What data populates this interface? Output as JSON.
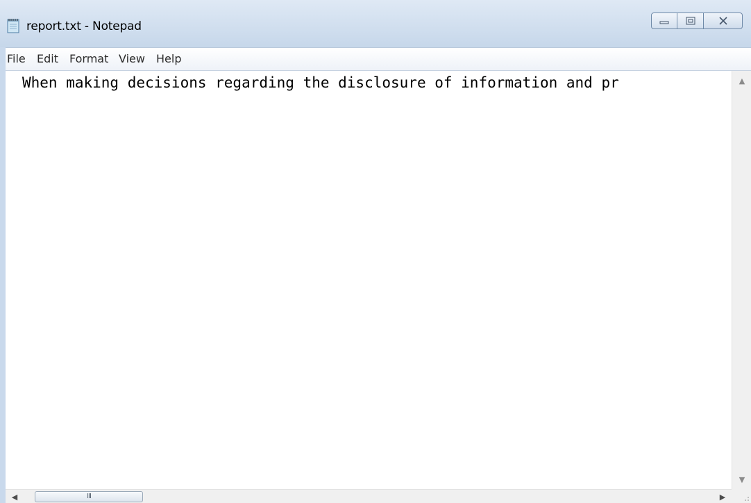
{
  "window": {
    "title": "report.txt - Notepad"
  },
  "caption_buttons": {
    "minimize": "minimize-icon",
    "maximize": "maximize-icon",
    "close": "close-icon"
  },
  "menu": {
    "items": [
      "File",
      "Edit",
      "Format",
      "View",
      "Help"
    ]
  },
  "editor": {
    "content": "When making decisions regarding the disclosure of information and pr"
  },
  "scrollbars": {
    "horizontal_grip": "III"
  },
  "colors": {
    "titlebar": "#c6d7ea",
    "menubar": "#eef2f8",
    "editor_bg": "#ffffff",
    "scrollbar_bg": "#f0f0f0"
  }
}
